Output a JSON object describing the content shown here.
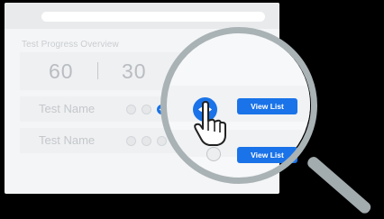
{
  "card": {
    "title": "Test Progress Overview",
    "stats": [
      "60",
      "30"
    ]
  },
  "rows": [
    {
      "name": "Test Name",
      "steps": [
        "pending",
        "pending",
        "done"
      ],
      "action_label": "View List"
    },
    {
      "name": "Test Name",
      "steps": [
        "pending",
        "pending",
        "pending"
      ],
      "action_label": "View List"
    }
  ],
  "icons": {
    "view": "eye-icon",
    "pointer": "hand-cursor-icon",
    "magnifier": "magnifying-glass-icon"
  },
  "colors": {
    "accent": "#1a73e8",
    "magnifier": "#a9b2b4",
    "faded_text": "#c5c8cb"
  }
}
